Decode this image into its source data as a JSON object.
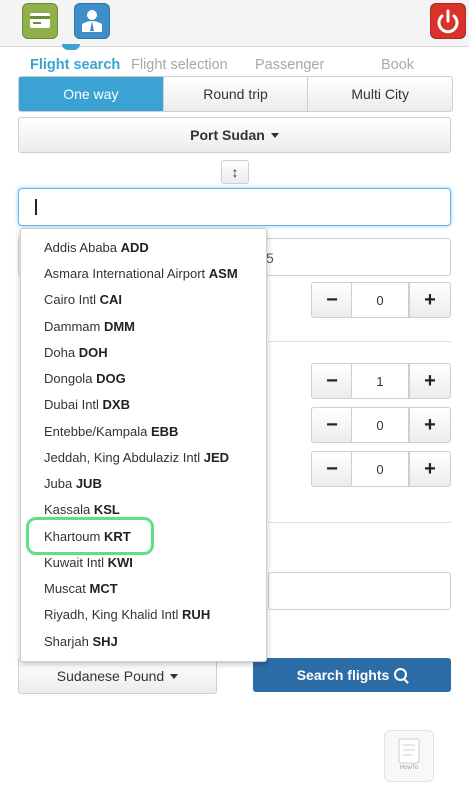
{
  "header": {
    "left_icons": [
      "card-icon",
      "user-icon"
    ],
    "right_icon": "power-icon"
  },
  "steps": [
    "Flight search",
    "Flight selection",
    "Passenger",
    "Book"
  ],
  "trip_types": [
    "One way",
    "Round trip",
    "Multi City"
  ],
  "origin": "Port Sudan",
  "swap_icon": "↕",
  "destination": {
    "value": ""
  },
  "date_fragment": "5",
  "passengers": [
    {
      "value": "0"
    },
    {
      "value": "1"
    },
    {
      "value": "0"
    },
    {
      "value": "0"
    }
  ],
  "stepper_labels": {
    "minus": "−",
    "plus": "+"
  },
  "dropdown": [
    {
      "name": "Addis Ababa",
      "code": "ADD"
    },
    {
      "name": "Asmara International Airport",
      "code": "ASM"
    },
    {
      "name": "Cairo Intl",
      "code": "CAI"
    },
    {
      "name": "Dammam",
      "code": "DMM"
    },
    {
      "name": "Doha",
      "code": "DOH"
    },
    {
      "name": "Dongola",
      "code": "DOG"
    },
    {
      "name": "Dubai Intl",
      "code": "DXB"
    },
    {
      "name": "Entebbe/Kampala",
      "code": "EBB"
    },
    {
      "name": "Jeddah, King Abdulaziz Intl",
      "code": "JED"
    },
    {
      "name": "Juba",
      "code": "JUB"
    },
    {
      "name": "Kassala",
      "code": "KSL"
    },
    {
      "name": "Khartoum",
      "code": "KRT"
    },
    {
      "name": "Kuwait Intl",
      "code": "KWI"
    },
    {
      "name": "Muscat",
      "code": "MCT"
    },
    {
      "name": "Riyadh, King Khalid Intl",
      "code": "RUH"
    },
    {
      "name": "Sharjah",
      "code": "SHJ"
    }
  ],
  "currency": "Sudanese Pound",
  "search_button": "Search flights",
  "howto_label": "HowTo",
  "colors": {
    "accent": "#3aa3d4",
    "search": "#2c6da8",
    "highlight": "#5ee08a"
  }
}
